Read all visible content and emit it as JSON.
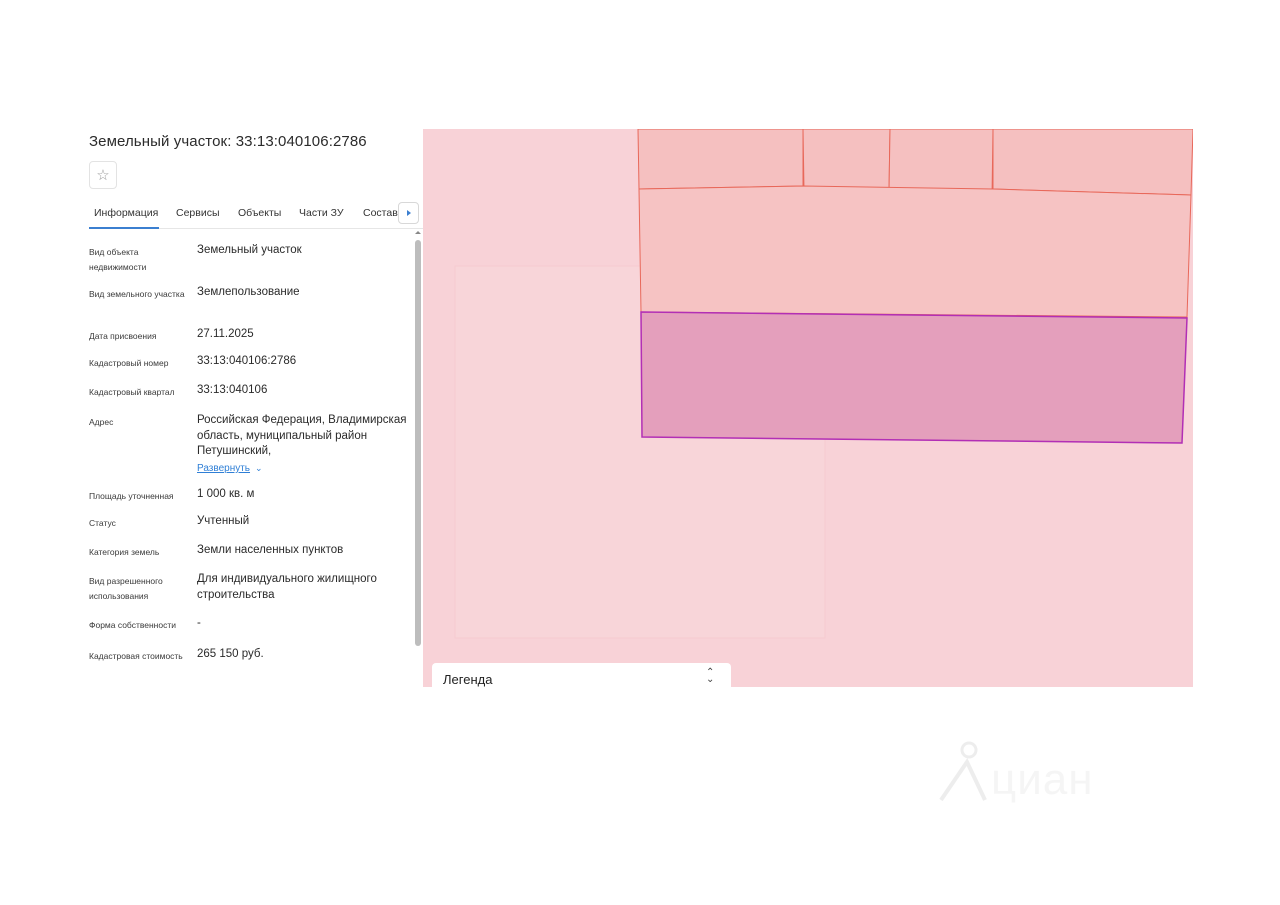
{
  "panel": {
    "title": "Земельный участок: 33:13:040106:2786",
    "favorite_icon": "star-icon",
    "tabs": [
      {
        "label": "Информация",
        "active": true
      },
      {
        "label": "Сервисы",
        "active": false
      },
      {
        "label": "Объекты",
        "active": false
      },
      {
        "label": "Части ЗУ",
        "active": false
      },
      {
        "label": "Состав",
        "active": false
      }
    ],
    "tabs_next_icon": "chevron-right-icon",
    "fields": [
      {
        "label": "Вид объекта недвижимости",
        "value": "Земельный участок"
      },
      {
        "label": "Вид земельного участка",
        "value": "Землепользование"
      },
      {
        "label": "Дата присвоения",
        "value": "27.11.2025"
      },
      {
        "label": "Кадастровый номер",
        "value": "33:13:040106:2786"
      },
      {
        "label": "Кадастровый квартал",
        "value": "33:13:040106"
      },
      {
        "label": "Адрес",
        "value": "Российская Федерация, Владимирская область, муниципальный район Петушинский,",
        "expand_label": "Развернуть"
      },
      {
        "label": "Площадь уточненная",
        "value": "1 000 кв. м"
      },
      {
        "label": "Статус",
        "value": "Учтенный"
      },
      {
        "label": "Категория земель",
        "value": "Земли населенных пунктов"
      },
      {
        "label": "Вид разрешенного использования",
        "value": "Для индивидуального жилищного строительства"
      },
      {
        "label": "Форма собственности",
        "value": "-"
      },
      {
        "label": "Кадастровая стоимость",
        "value": "265 150 руб."
      }
    ]
  },
  "map": {
    "background_color": "#f8d2d7",
    "parcel_fill": "#f5c0c0",
    "parcel_stroke": "#e8685a",
    "selected_fill": "#e49fbc",
    "selected_stroke": "#b22fb5"
  },
  "legend": {
    "title": "Легенда",
    "toggle_icon": "chevron-up-down-icon"
  },
  "watermark": {
    "text": "циан",
    "icon": "cian-logo-icon"
  }
}
